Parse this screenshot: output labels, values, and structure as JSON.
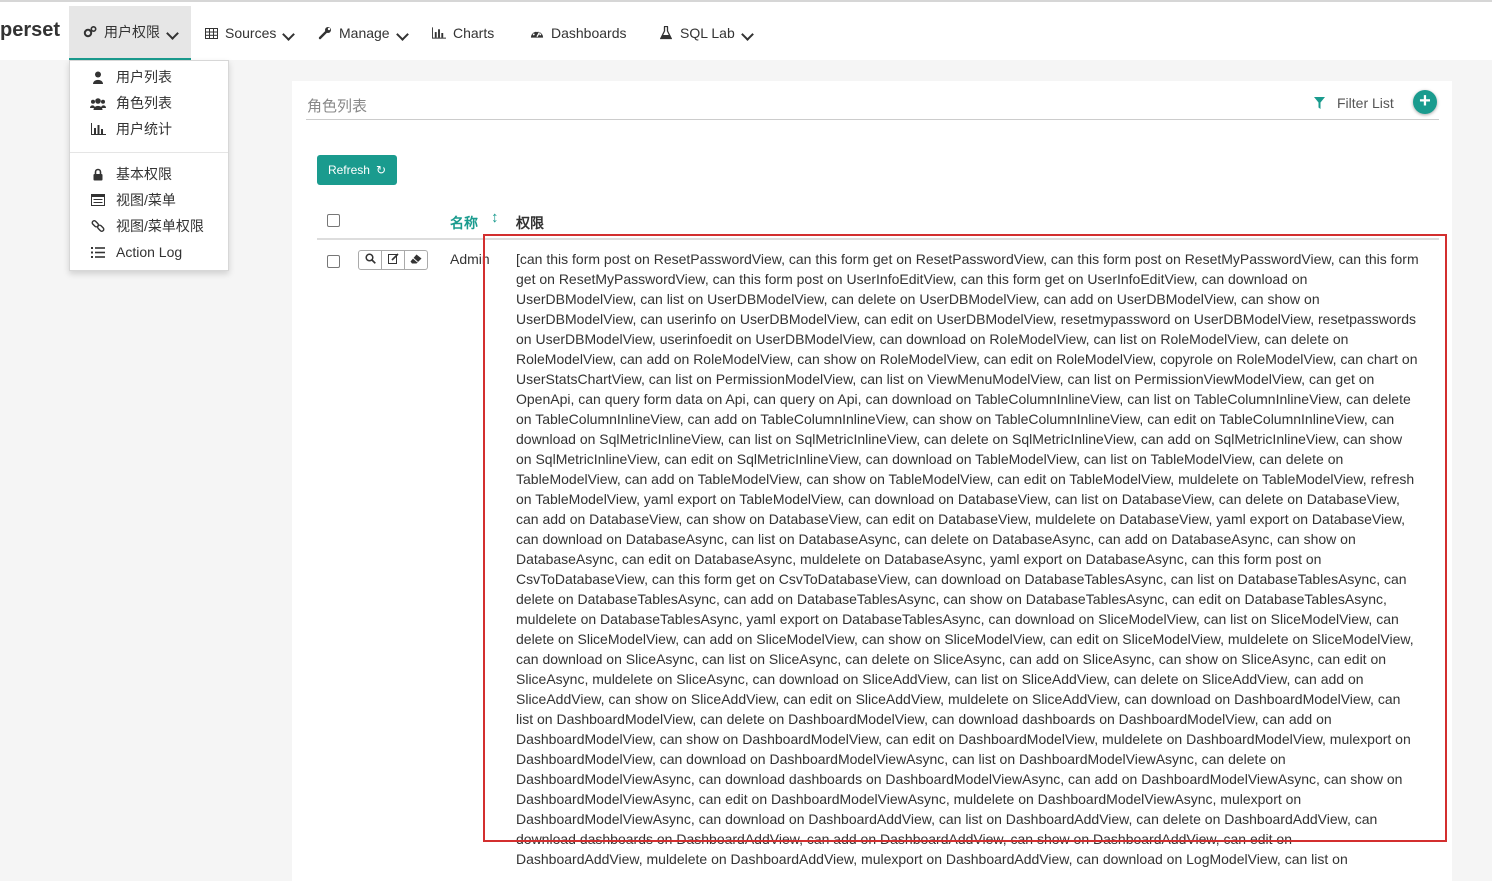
{
  "navbar": {
    "brand": "perset",
    "items": [
      {
        "label": "用户权限",
        "icon": "cogs-icon",
        "has_caret": true
      },
      {
        "label": "Sources",
        "icon": "table-icon",
        "has_caret": true
      },
      {
        "label": "Manage",
        "icon": "wrench-icon",
        "has_caret": true
      },
      {
        "label": "Charts",
        "icon": "bar-chart-icon",
        "has_caret": false
      },
      {
        "label": "Dashboards",
        "icon": "dashboard-icon",
        "has_caret": false
      },
      {
        "label": "SQL Lab",
        "icon": "flask-icon",
        "has_caret": true
      }
    ]
  },
  "dropdown": {
    "items": [
      {
        "label": "用户列表",
        "icon": "user-icon"
      },
      {
        "label": "角色列表",
        "icon": "group-icon"
      },
      {
        "label": "用户统计",
        "icon": "bar-chart-icon"
      },
      {
        "label": "基本权限",
        "icon": "lock-icon"
      },
      {
        "label": "视图/菜单",
        "icon": "list-alt-icon"
      },
      {
        "label": "视图/菜单权限",
        "icon": "link-icon"
      },
      {
        "label": "Action Log",
        "icon": "list-ol-icon"
      }
    ]
  },
  "panel": {
    "title": "角色列表",
    "filter_label": "Filter List",
    "add_label": "+",
    "refresh_label": "Refresh",
    "columns": {
      "name": "名称",
      "permissions": "权限"
    },
    "rows": [
      {
        "name": "Admin",
        "permissions": "[can this form post on ResetPasswordView, can this form get on ResetPasswordView, can this form post on ResetMyPasswordView, can this form get on ResetMyPasswordView, can this form post on UserInfoEditView, can this form get on UserInfoEditView, can download on UserDBModelView, can list on UserDBModelView, can delete on UserDBModelView, can add on UserDBModelView, can show on UserDBModelView, can userinfo on UserDBModelView, can edit on UserDBModelView, resetmypassword on UserDBModelView, resetpasswords on UserDBModelView, userinfoedit on UserDBModelView, can download on RoleModelView, can list on RoleModelView, can delete on RoleModelView, can add on RoleModelView, can show on RoleModelView, can edit on RoleModelView, copyrole on RoleModelView, can chart on UserStatsChartView, can list on PermissionModelView, can list on ViewMenuModelView, can list on PermissionViewModelView, can get on OpenApi, can query form data on Api, can query on Api, can download on TableColumnInlineView, can list on TableColumnInlineView, can delete on TableColumnInlineView, can add on TableColumnInlineView, can show on TableColumnInlineView, can edit on TableColumnInlineView, can download on SqlMetricInlineView, can list on SqlMetricInlineView, can delete on SqlMetricInlineView, can add on SqlMetricInlineView, can show on SqlMetricInlineView, can edit on SqlMetricInlineView, can download on TableModelView, can list on TableModelView, can delete on TableModelView, can add on TableModelView, can show on TableModelView, can edit on TableModelView, muldelete on TableModelView, refresh on TableModelView, yaml export on TableModelView, can download on DatabaseView, can list on DatabaseView, can delete on DatabaseView, can add on DatabaseView, can show on DatabaseView, can edit on DatabaseView, muldelete on DatabaseView, yaml export on DatabaseView, can download on DatabaseAsync, can list on DatabaseAsync, can delete on DatabaseAsync, can add on DatabaseAsync, can show on DatabaseAsync, can edit on DatabaseAsync, muldelete on DatabaseAsync, yaml export on DatabaseAsync, can this form post on CsvToDatabaseView, can this form get on CsvToDatabaseView, can download on DatabaseTablesAsync, can list on DatabaseTablesAsync, can delete on DatabaseTablesAsync, can add on DatabaseTablesAsync, can show on DatabaseTablesAsync, can edit on DatabaseTablesAsync, muldelete on DatabaseTablesAsync, yaml export on DatabaseTablesAsync, can download on SliceModelView, can list on SliceModelView, can delete on SliceModelView, can add on SliceModelView, can show on SliceModelView, can edit on SliceModelView, muldelete on SliceModelView, can download on SliceAsync, can list on SliceAsync, can delete on SliceAsync, can add on SliceAsync, can show on SliceAsync, can edit on SliceAsync, muldelete on SliceAsync, can download on SliceAddView, can list on SliceAddView, can delete on SliceAddView, can add on SliceAddView, can show on SliceAddView, can edit on SliceAddView, muldelete on SliceAddView, can download on DashboardModelView, can list on DashboardModelView, can delete on DashboardModelView, can download dashboards on DashboardModelView, can add on DashboardModelView, can show on DashboardModelView, can edit on DashboardModelView, muldelete on DashboardModelView, mulexport on DashboardModelView, can download on DashboardModelViewAsync, can list on DashboardModelViewAsync, can delete on DashboardModelViewAsync, can download dashboards on DashboardModelViewAsync, can add on DashboardModelViewAsync, can show on DashboardModelViewAsync, can edit on DashboardModelViewAsync, muldelete on DashboardModelViewAsync, mulexport on DashboardModelViewAsync, can download on DashboardAddView, can list on DashboardAddView, can delete on DashboardAddView, can download dashboards on DashboardAddView, can add on DashboardAddView, can show on DashboardAddView, can edit on DashboardAddView, muldelete on DashboardAddView, mulexport on DashboardAddView, can download on LogModelView, can list on"
      }
    ]
  },
  "colors": {
    "accent": "#1a9b8e",
    "highlight": "#d32f2f"
  }
}
